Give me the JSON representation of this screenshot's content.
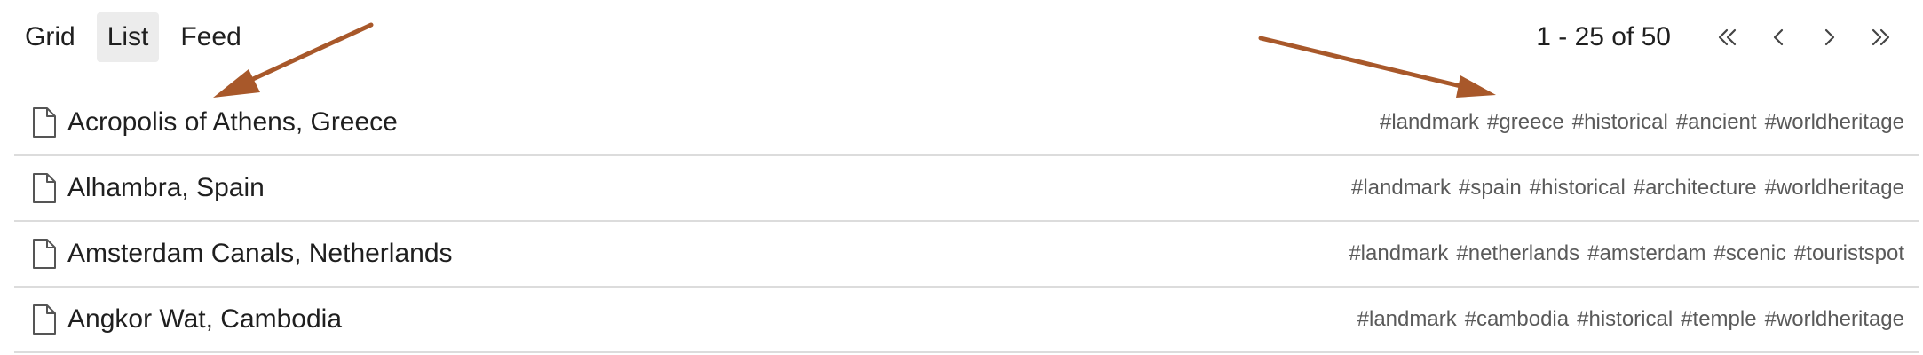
{
  "view_tabs": [
    {
      "label": "Grid",
      "active": false
    },
    {
      "label": "List",
      "active": true
    },
    {
      "label": "Feed",
      "active": false
    }
  ],
  "pagination": {
    "range_label": "1 - 25 of 50",
    "buttons": [
      "first-page-icon",
      "previous-page-icon",
      "next-page-icon",
      "last-page-icon"
    ]
  },
  "rows": [
    {
      "icon": "document-icon",
      "title": "Acropolis of Athens, Greece",
      "tags": [
        "#landmark",
        "#greece",
        "#historical",
        "#ancient",
        "#worldheritage"
      ]
    },
    {
      "icon": "document-icon",
      "title": "Alhambra, Spain",
      "tags": [
        "#landmark",
        "#spain",
        "#historical",
        "#architecture",
        "#worldheritage"
      ]
    },
    {
      "icon": "document-icon",
      "title": "Amsterdam Canals, Netherlands",
      "tags": [
        "#landmark",
        "#netherlands",
        "#amsterdam",
        "#scenic",
        "#touristspot"
      ]
    },
    {
      "icon": "document-icon",
      "title": "Angkor Wat, Cambodia",
      "tags": [
        "#landmark",
        "#cambodia",
        "#historical",
        "#temple",
        "#worldheritage"
      ]
    }
  ],
  "colors": {
    "annotation_arrow": "#a8582a",
    "active_tab_bg": "#ececec",
    "divider": "#dcdcdc",
    "tag_text": "#5a5a5a"
  }
}
